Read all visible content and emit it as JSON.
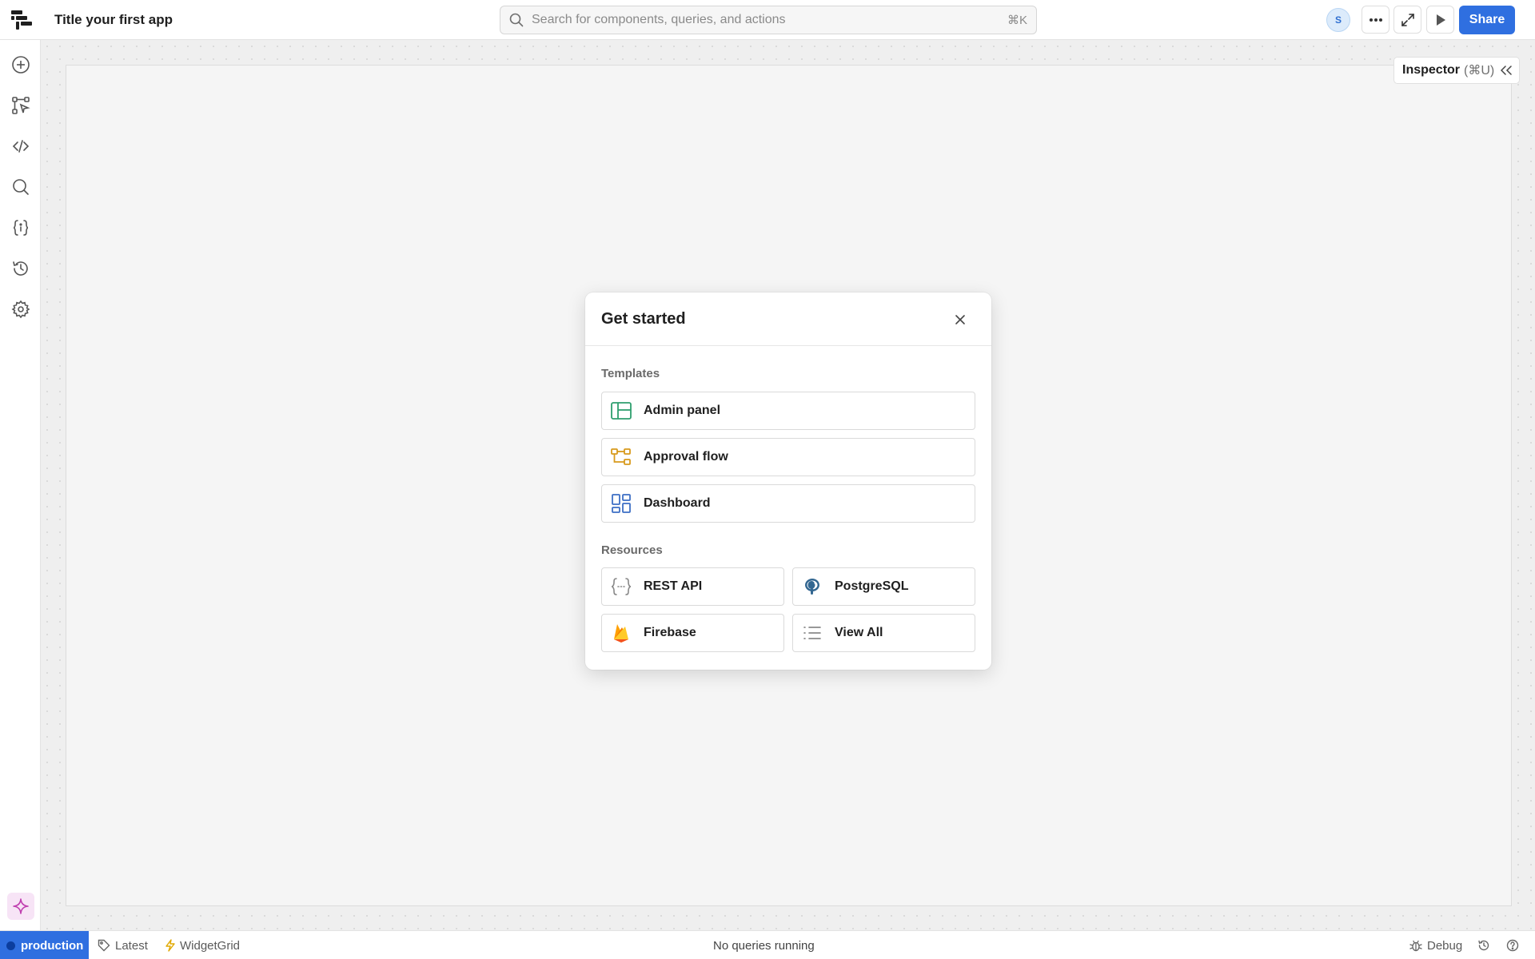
{
  "header": {
    "app_title": "Title your first app",
    "search_placeholder": "Search for components, queries, and actions",
    "search_shortcut": "⌘K",
    "avatar_initial": "S",
    "share_label": "Share"
  },
  "inspector": {
    "label": "Inspector",
    "shortcut": "(⌘U)"
  },
  "rail": {
    "icons": [
      "add-icon",
      "workflow-icon",
      "code-icon",
      "search-icon",
      "variables-icon",
      "history-icon",
      "settings-icon",
      "assist-sparkle-icon"
    ]
  },
  "modal": {
    "title": "Get started",
    "templates_label": "Templates",
    "templates": [
      {
        "label": "Admin panel",
        "icon": "admin-panel-icon",
        "color": "#2e9e6e"
      },
      {
        "label": "Approval flow",
        "icon": "approval-flow-icon",
        "color": "#d89a1c"
      },
      {
        "label": "Dashboard",
        "icon": "dashboard-icon",
        "color": "#3d6fc5"
      }
    ],
    "resources_label": "Resources",
    "resources": [
      {
        "label": "REST API",
        "icon": "rest-api-icon"
      },
      {
        "label": "PostgreSQL",
        "icon": "postgresql-icon"
      },
      {
        "label": "Firebase",
        "icon": "firebase-icon"
      },
      {
        "label": "View All",
        "icon": "list-icon"
      }
    ]
  },
  "footer": {
    "environment": "production",
    "version": "Latest",
    "component": "WidgetGrid",
    "status": "No queries running",
    "debug": "Debug"
  },
  "colors": {
    "accent": "#2f6fe0",
    "environment": "#2f6fe0",
    "assist_bg": "#f7e4f6"
  }
}
